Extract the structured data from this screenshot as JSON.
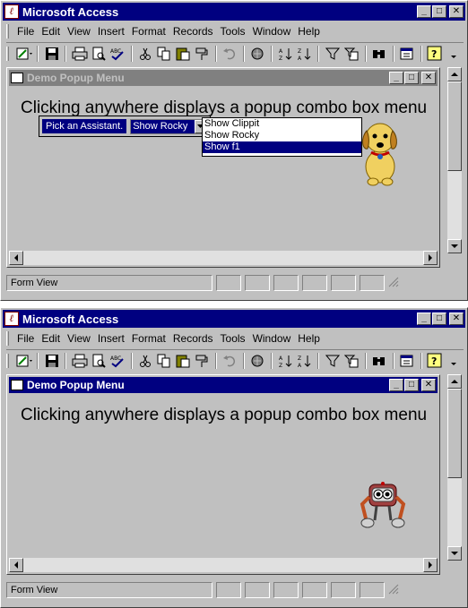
{
  "app": {
    "title": "Microsoft Access"
  },
  "menu": [
    "File",
    "Edit",
    "View",
    "Insert",
    "Format",
    "Records",
    "Tools",
    "Window",
    "Help"
  ],
  "form": {
    "title": "Demo Popup Menu",
    "heading": "Clicking anywhere displays a popup combo box menu"
  },
  "combo": {
    "label": "Pick an Assistant.",
    "value": "Show Rocky",
    "options": [
      "Show Clippit",
      "Show Rocky",
      "Show f1"
    ],
    "selected_option": "Show f1"
  },
  "status": {
    "text": "Form View"
  },
  "assistants": {
    "top": "rocky-dog",
    "bottom": "f1-robot"
  },
  "colors": {
    "title_active": "#000080",
    "chrome": "#c0c0c0"
  }
}
